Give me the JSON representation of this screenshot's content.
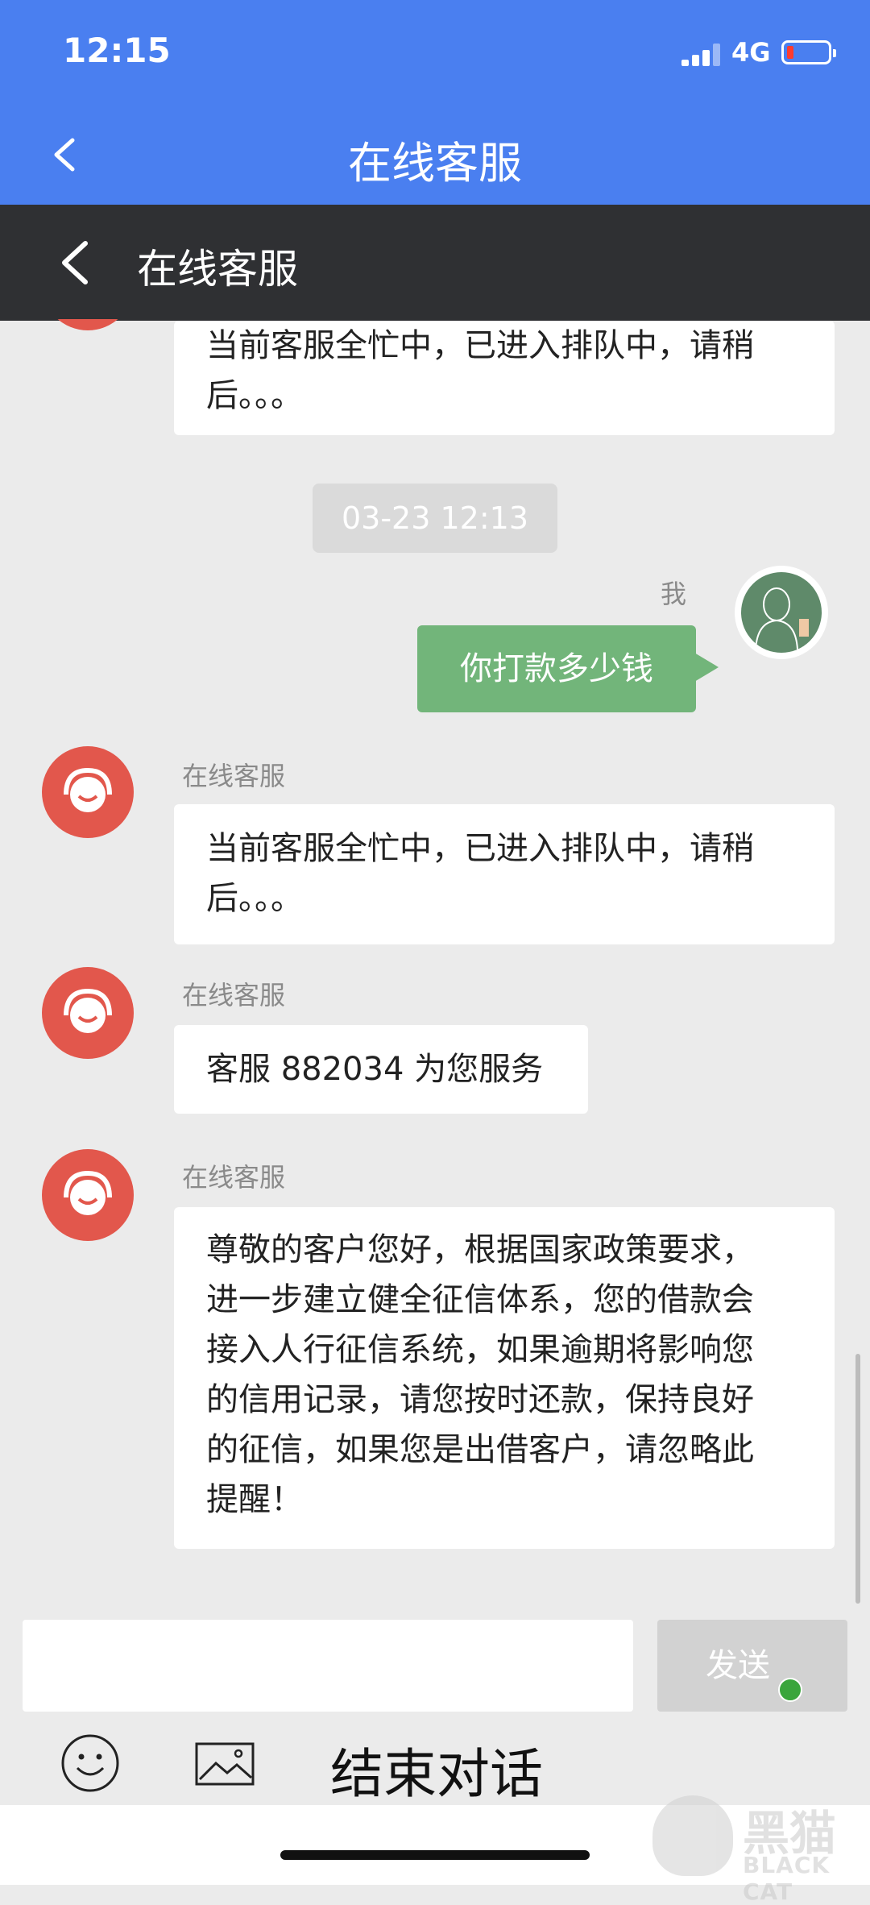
{
  "status_bar": {
    "time": "12:15",
    "network": "4G"
  },
  "app_bar": {
    "title": "在线客服"
  },
  "sub_bar": {
    "title": "在线客服"
  },
  "messages": [
    {
      "sender": "",
      "text_lines": [
        "当前客服全忙中，已进入排队中，请稍",
        "后。。。"
      ]
    },
    {
      "timestamp": "03-23 12:13"
    },
    {
      "sender": "我",
      "text": "你打款多少钱"
    },
    {
      "sender": "在线客服",
      "text_lines": [
        "当前客服全忙中，已进入排队中，请稍",
        "后。。。"
      ]
    },
    {
      "sender": "在线客服",
      "text": "客服 882034 为您服务"
    },
    {
      "sender": "在线客服",
      "text_lines": [
        "尊敬的客户您好，根据国家政策要求，",
        "进一步建立健全征信体系，您的借款会",
        "接入人行征信系统，如果逾期将影响您",
        "的信用记录，请您按时还款，保持良好",
        "的征信，如果您是出借客户，请忽略此",
        "提醒！"
      ]
    }
  ],
  "composer": {
    "placeholder": "",
    "send_label": "发送"
  },
  "toolbar": {
    "end_chat_label": "结束对话"
  },
  "watermark": {
    "cn": "黑猫",
    "en": "BLACK CAT"
  },
  "colors": {
    "primary": "#4a7ff0",
    "dark_bar": "#2f3033",
    "agent_avatar": "#e2574c",
    "my_bubble": "#72b57a"
  }
}
